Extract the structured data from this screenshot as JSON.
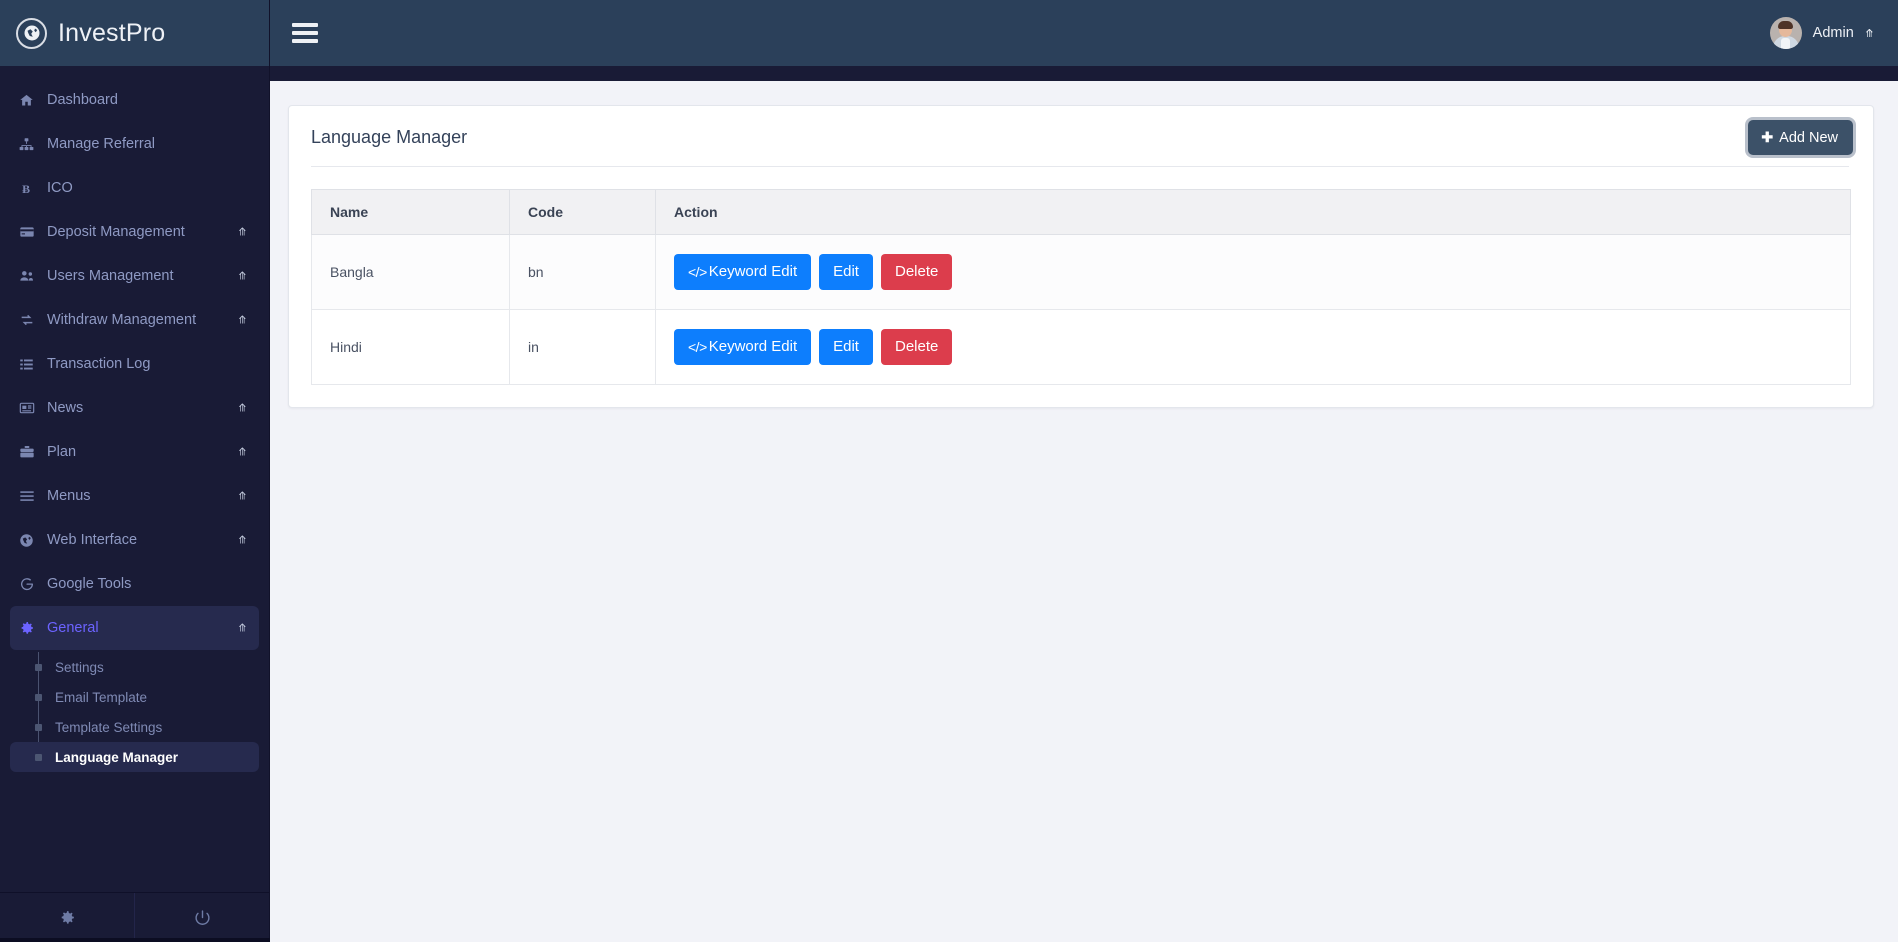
{
  "brand": {
    "name": "InvestPro",
    "logo_icon": "globe-icon"
  },
  "topbar": {
    "menu_icon": "hamburger-icon",
    "user_name": "Admin",
    "user_caret_icon": "chevron-down-icon",
    "avatar_icon": "user-avatar"
  },
  "sidebar": {
    "items": [
      {
        "label": "Dashboard",
        "icon": "home-icon",
        "has_caret": false,
        "active": false
      },
      {
        "label": "Manage Referral",
        "icon": "sitemap-icon",
        "has_caret": false,
        "active": false
      },
      {
        "label": "ICO",
        "icon": "bitcoin-icon",
        "has_caret": false,
        "active": false
      },
      {
        "label": "Deposit Management",
        "icon": "credit-card-icon",
        "has_caret": true,
        "active": false
      },
      {
        "label": "Users Management",
        "icon": "users-icon",
        "has_caret": true,
        "active": false
      },
      {
        "label": "Withdraw Management",
        "icon": "exchange-icon",
        "has_caret": true,
        "active": false
      },
      {
        "label": "Transaction Log",
        "icon": "list-icon",
        "has_caret": false,
        "active": false
      },
      {
        "label": "News",
        "icon": "newspaper-icon",
        "has_caret": true,
        "active": false
      },
      {
        "label": "Plan",
        "icon": "briefcase-icon",
        "has_caret": true,
        "active": false
      },
      {
        "label": "Menus",
        "icon": "bars-icon",
        "has_caret": true,
        "active": false
      },
      {
        "label": "Web Interface",
        "icon": "globe-icon",
        "has_caret": true,
        "active": false
      },
      {
        "label": "Google Tools",
        "icon": "google-icon",
        "has_caret": false,
        "active": false
      },
      {
        "label": "General",
        "icon": "gear-icon",
        "has_caret": true,
        "active": true
      }
    ],
    "submenu": [
      {
        "label": "Settings",
        "active": false
      },
      {
        "label": "Email Template",
        "active": false
      },
      {
        "label": "Template Settings",
        "active": false
      },
      {
        "label": "Language Manager",
        "active": true
      }
    ],
    "footer": [
      {
        "icon": "gear-icon",
        "name": "settings-icon"
      },
      {
        "icon": "power-icon",
        "name": "logout-icon"
      }
    ],
    "active_accent_color": "#6c63ff"
  },
  "page": {
    "title": "Language Manager",
    "add_new_label": "Add New",
    "add_new_icon": "plus-icon"
  },
  "table": {
    "headers": [
      "Name",
      "Code",
      "Action"
    ],
    "rows": [
      {
        "name": "Bangla",
        "code": "bn",
        "keyword_edit_label": "Keyword Edit",
        "keyword_edit_icon": "code-icon",
        "edit_label": "Edit",
        "delete_label": "Delete"
      },
      {
        "name": "Hindi",
        "code": "in",
        "keyword_edit_label": "Keyword Edit",
        "keyword_edit_icon": "code-icon",
        "edit_label": "Edit",
        "delete_label": "Delete"
      }
    ]
  },
  "colors": {
    "sidebar_bg": "#191b36",
    "topbar_bg": "#2b405a",
    "page_bg": "#f2f3f8",
    "primary_button": "#0d7efd",
    "danger_button": "#dc3d4c",
    "add_button": "#3c5168"
  }
}
